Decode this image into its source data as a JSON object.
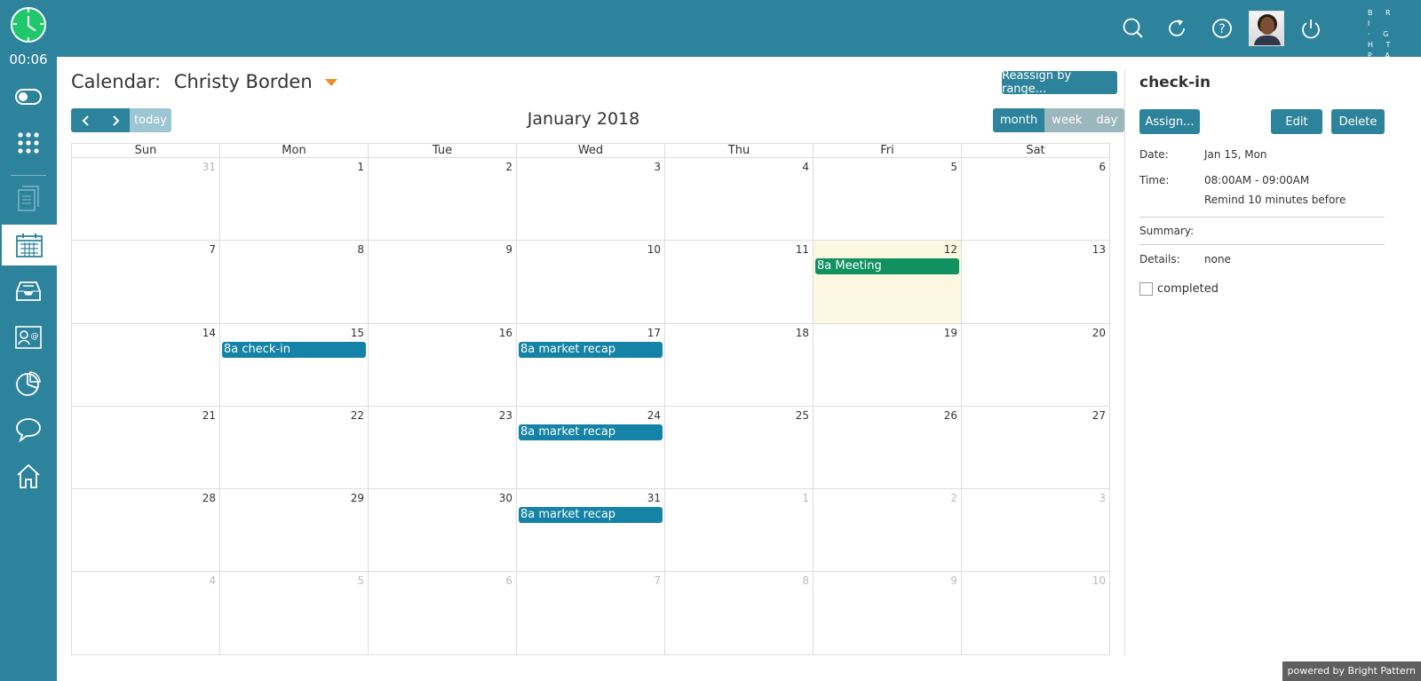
{
  "timer": "00:06",
  "brand": "BRIGHTPATTERN",
  "calendar": {
    "title": "Calendar:",
    "owner": "Christy Borden",
    "month_title": "January 2018",
    "reassign_label": "Reassign by range...",
    "today_label": "today",
    "prev_label": "<",
    "next_label": ">",
    "views": [
      "month",
      "week",
      "day"
    ],
    "active_view": "month",
    "days_of_week": [
      "Sun",
      "Mon",
      "Tue",
      "Wed",
      "Thu",
      "Fri",
      "Sat"
    ],
    "weeks": [
      [
        {
          "n": "31",
          "o": true
        },
        {
          "n": "1"
        },
        {
          "n": "2"
        },
        {
          "n": "3"
        },
        {
          "n": "4"
        },
        {
          "n": "5"
        },
        {
          "n": "6"
        }
      ],
      [
        {
          "n": "7"
        },
        {
          "n": "8"
        },
        {
          "n": "9"
        },
        {
          "n": "10"
        },
        {
          "n": "11"
        },
        {
          "n": "12",
          "today": true,
          "event": {
            "label": "8a Meeting",
            "color": "#0f9160"
          }
        },
        {
          "n": "13"
        }
      ],
      [
        {
          "n": "14"
        },
        {
          "n": "15",
          "event": {
            "label": "8a check-in",
            "color": "#1483a6"
          }
        },
        {
          "n": "16"
        },
        {
          "n": "17",
          "event": {
            "label": "8a market recap",
            "color": "#1483a6"
          }
        },
        {
          "n": "18"
        },
        {
          "n": "19"
        },
        {
          "n": "20"
        }
      ],
      [
        {
          "n": "21"
        },
        {
          "n": "22"
        },
        {
          "n": "23"
        },
        {
          "n": "24",
          "event": {
            "label": "8a market recap",
            "color": "#1483a6"
          }
        },
        {
          "n": "25"
        },
        {
          "n": "26"
        },
        {
          "n": "27"
        }
      ],
      [
        {
          "n": "28"
        },
        {
          "n": "29"
        },
        {
          "n": "30"
        },
        {
          "n": "31",
          "event": {
            "label": "8a market recap",
            "color": "#1483a6"
          }
        },
        {
          "n": "1",
          "o": true
        },
        {
          "n": "2",
          "o": true
        },
        {
          "n": "3",
          "o": true
        }
      ],
      [
        {
          "n": "4",
          "o": true
        },
        {
          "n": "5",
          "o": true
        },
        {
          "n": "6",
          "o": true
        },
        {
          "n": "7",
          "o": true
        },
        {
          "n": "8",
          "o": true
        },
        {
          "n": "9",
          "o": true
        },
        {
          "n": "10",
          "o": true
        }
      ]
    ]
  },
  "details": {
    "title": "check-in",
    "assign_label": "Assign...",
    "edit_label": "Edit",
    "delete_label": "Delete",
    "date_label": "Date:",
    "date_value": "Jan 15, Mon",
    "time_label": "Time:",
    "time_value": "08:00AM - 09:00AM",
    "remind_value": "Remind 10 minutes before",
    "summary_label": "Summary:",
    "details_label": "Details:",
    "details_value": "none",
    "completed_label": "completed"
  },
  "footer": {
    "powered": "powered by Bright Pattern"
  },
  "colors": {
    "accent": "#2e839c",
    "today_bg": "#fcf7e0",
    "event_blue": "#1483a6",
    "event_green": "#0f9160",
    "clock_green": "#1fc86a",
    "caret_orange": "#f08a1e"
  },
  "icons": {
    "top": [
      "search-icon",
      "refresh-icon",
      "help-icon",
      "avatar",
      "power-icon"
    ],
    "side": [
      "status-toggle-icon",
      "dialpad-icon",
      "documents-icon",
      "calendar-icon",
      "inbox-icon",
      "contacts-icon",
      "reports-icon",
      "chat-icon",
      "home-icon"
    ]
  }
}
